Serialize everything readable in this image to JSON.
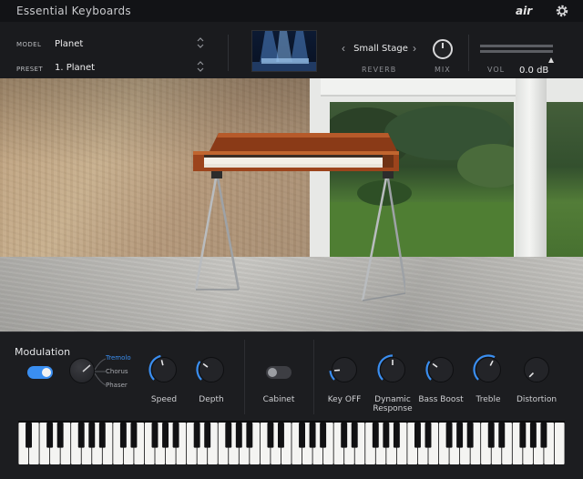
{
  "titlebar": {
    "app_title": "Essential Keyboards",
    "brand": "air",
    "settings_icon": "gear-icon"
  },
  "header": {
    "model_label": "MODEL",
    "model_value": "Planet",
    "preset_label": "PRESET",
    "preset_value": "1. Planet",
    "room_prev": "‹",
    "room_next": "›",
    "room_name": "Small Stage",
    "reverb_label": "REVERB",
    "mix_label": "MIX",
    "vol_label": "VOL",
    "vol_value": "0.0 dB"
  },
  "panel": {
    "modulation_title": "Modulation",
    "modulation_on": true,
    "modes": [
      "Tremolo",
      "Chorus",
      "Phaser"
    ],
    "active_mode": "Tremolo",
    "knobs": [
      {
        "name": "speed",
        "label": "Speed",
        "value": 0.45
      },
      {
        "name": "depth",
        "label": "Depth",
        "value": 0.3
      },
      {
        "name": "key-off",
        "label": "Key OFF",
        "value": 0.15
      },
      {
        "name": "dynamic-response",
        "label": "Dynamic Response",
        "value": 0.5
      },
      {
        "name": "bass-boost",
        "label": "Bass Boost",
        "value": 0.3
      },
      {
        "name": "treble",
        "label": "Treble",
        "value": 0.6
      },
      {
        "name": "distortion",
        "label": "Distortion",
        "value": 0.0
      }
    ],
    "cabinet_label": "Cabinet",
    "cabinet_on": false
  },
  "colors": {
    "accent": "#3a8ef0",
    "panel": "#1c1d20",
    "header": "#1a1b1e"
  }
}
